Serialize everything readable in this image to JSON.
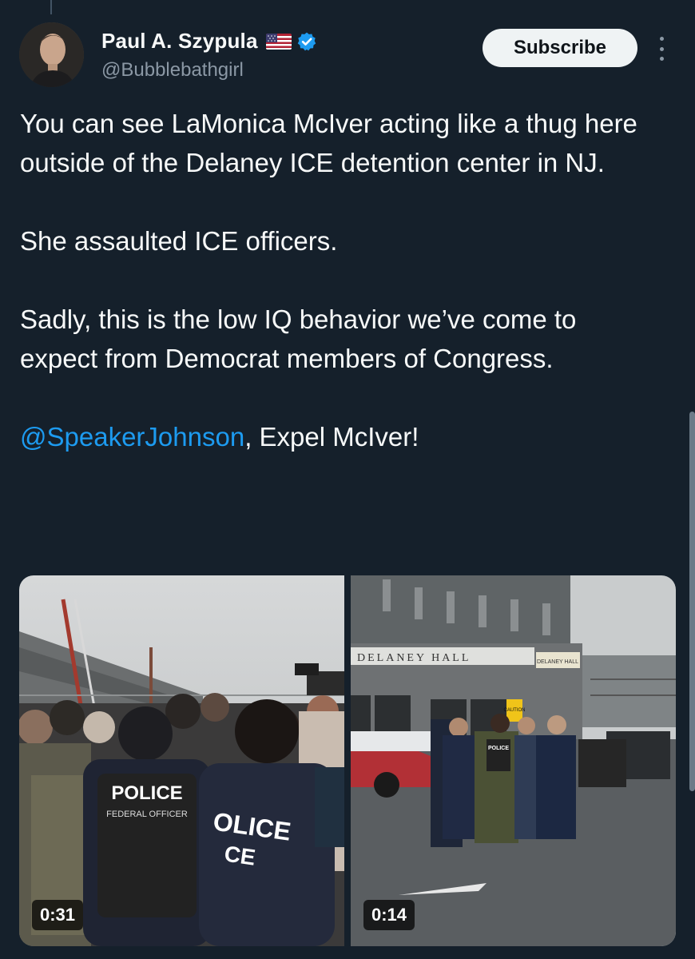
{
  "author": {
    "name": "Paul A. Szypula",
    "handle": "@Bubblebathgirl",
    "flag_icon": "us-flag-icon",
    "verified_icon": "verified-badge-icon",
    "verified_color": "#1d9bf0"
  },
  "actions": {
    "subscribe_label": "Subscribe",
    "more_icon": "more-vertical-icon"
  },
  "tweet": {
    "paragraphs": [
      "You can see LaMonica McIver acting like a thug here outside of the Delaney ICE detention center in NJ.",
      "She assaulted ICE officers.",
      "Sadly, this is the low IQ behavior we’ve come to expect from Democrat members of Congress."
    ],
    "mention": "@SpeakerJohnson",
    "closing": ", Expel McIver!"
  },
  "media": [
    {
      "duration": "0:31",
      "vest_text": "POLICE",
      "vest_subtext": "FEDERAL OFFICER",
      "jacket_text": "OLICE",
      "jacket_subtext": "CE"
    },
    {
      "duration": "0:14",
      "building_sign": "DELANEY   HALL",
      "small_sign": "DELANEY HALL",
      "caution_sign": "CAUTION",
      "vest_text": "POLICE"
    }
  ],
  "colors": {
    "background": "#15202b",
    "text": "#f7f9f9",
    "secondary_text": "#8b98a5",
    "link": "#1d9bf0"
  }
}
